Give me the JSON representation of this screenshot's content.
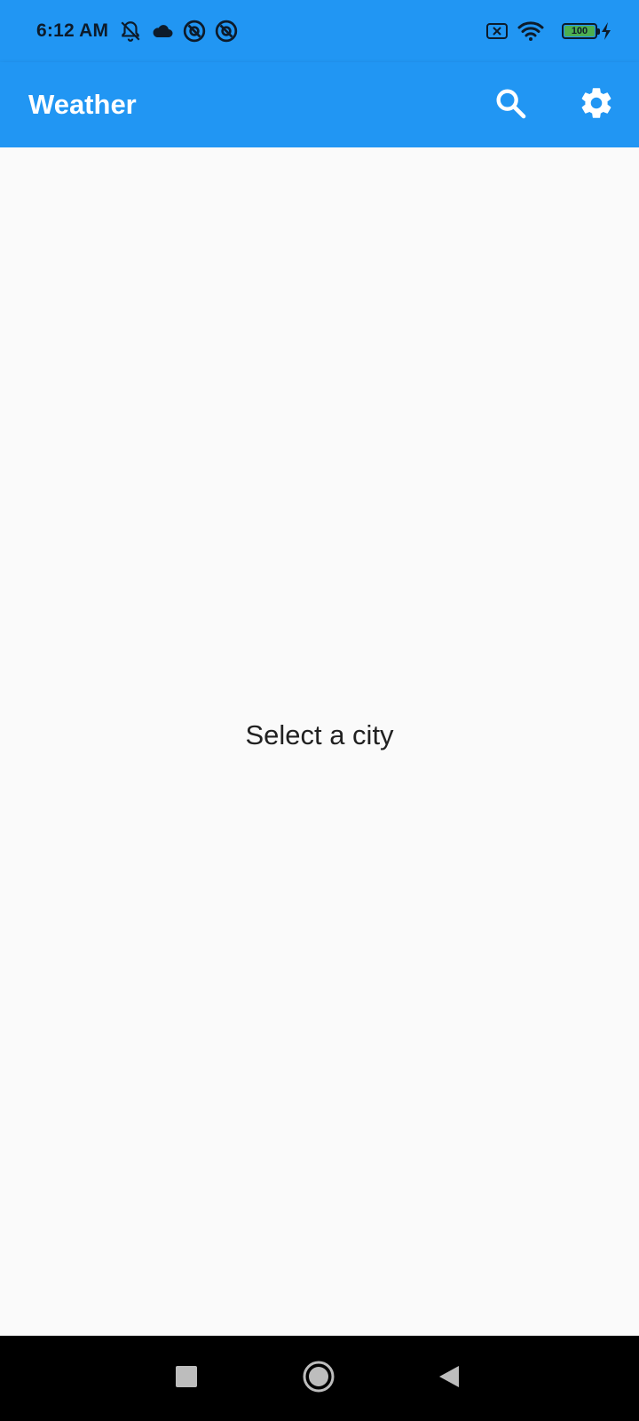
{
  "status_bar": {
    "time": "6:12 AM",
    "battery_level": "100",
    "battery_fraction": 1.0,
    "left_icons": [
      "notifications-off-icon",
      "cloud-icon",
      "at-sign-icon",
      "at-sign-icon"
    ],
    "right_icons": [
      "no-sim-icon",
      "wifi-icon",
      "battery-icon",
      "charging-bolt-icon"
    ]
  },
  "app_bar": {
    "title": "Weather",
    "actions": [
      "search-icon",
      "settings-gear-icon"
    ],
    "background_color": "#2196f3"
  },
  "main": {
    "message": "Select a city"
  },
  "nav_bar": {
    "buttons": [
      "recents-square-icon",
      "home-circle-icon",
      "back-triangle-icon"
    ]
  },
  "colors": {
    "primary": "#2196f3",
    "background": "#fafafa",
    "text": "#212121",
    "battery_fill": "#4caf50"
  }
}
